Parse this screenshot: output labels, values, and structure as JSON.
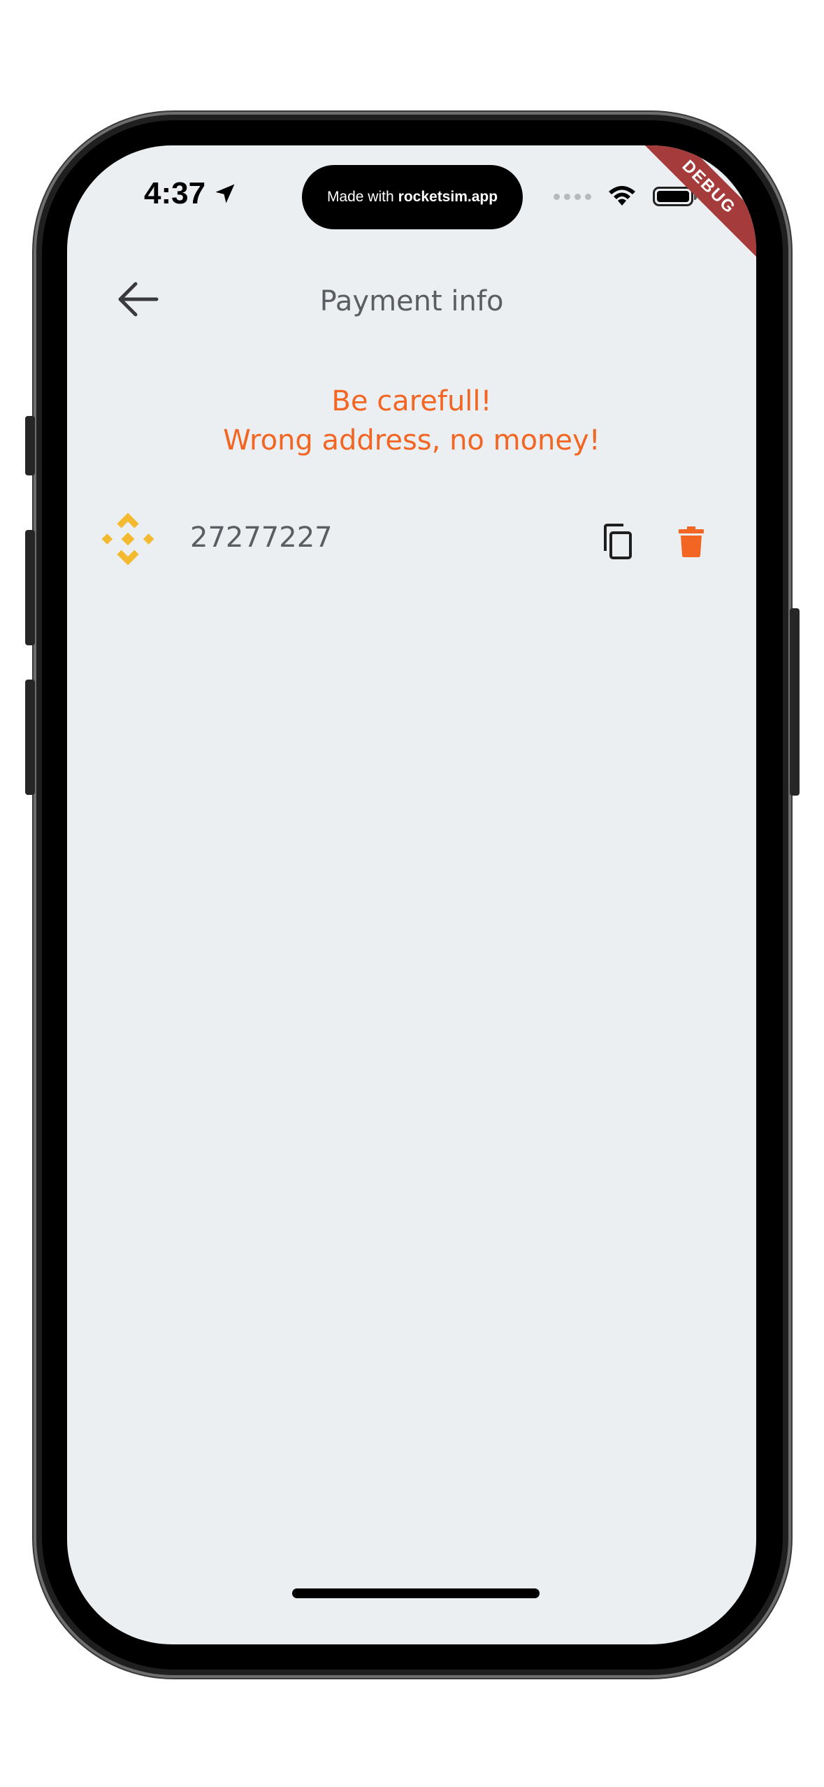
{
  "status_bar": {
    "time": "4:37",
    "island_prefix": "Made with",
    "island_brand": "rocketsim.app",
    "debug_label": "DEBUG"
  },
  "appbar": {
    "title": "Payment info",
    "back_icon": "arrow-left-icon"
  },
  "warning": {
    "line1": "Be carefull!",
    "line2": "Wrong address, no money!",
    "color": "#f26522"
  },
  "wallet": {
    "coin_icon": "binance-icon",
    "address": "27277227",
    "copy_icon": "copy-icon",
    "delete_icon": "trash-icon",
    "coin_color": "#f3ba2f",
    "delete_color": "#f26522"
  }
}
